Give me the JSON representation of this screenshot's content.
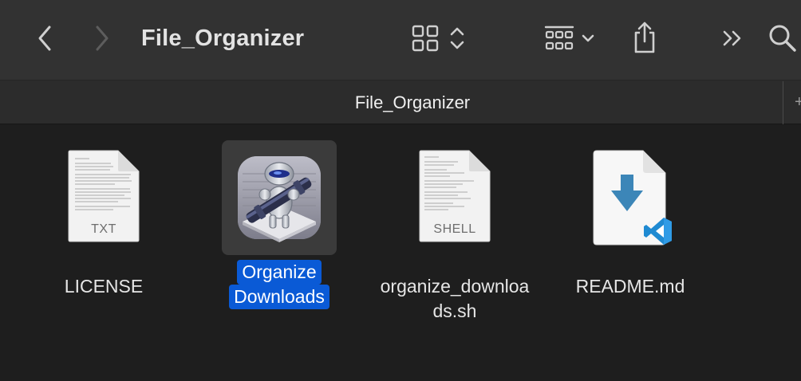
{
  "window": {
    "title": "File_Organizer",
    "tab_title": "File_Organizer"
  },
  "toolbar": {
    "icons": [
      "chevron-left-icon",
      "chevron-right-icon",
      "grid-view-icon",
      "group-by-icon",
      "share-icon",
      "more-icon",
      "search-icon"
    ]
  },
  "files": [
    {
      "name": "LICENSE",
      "kind_badge": "TXT",
      "icon": "text-document-icon",
      "selected": false
    },
    {
      "name_line1": "Organize",
      "name_line2": "Downloads",
      "icon": "automator-robot-icon",
      "selected": true
    },
    {
      "name_line1": "organize_downloa",
      "name_line2": "ds.sh",
      "kind_badge": "SHELL",
      "icon": "shell-script-icon",
      "selected": false
    },
    {
      "name": "README.md",
      "icon": "vscode-markdown-icon",
      "selected": false
    }
  ],
  "colors": {
    "toolbar_bg": "#323232",
    "content_bg": "#1e1e1e",
    "selection": "#0a5ad6"
  }
}
